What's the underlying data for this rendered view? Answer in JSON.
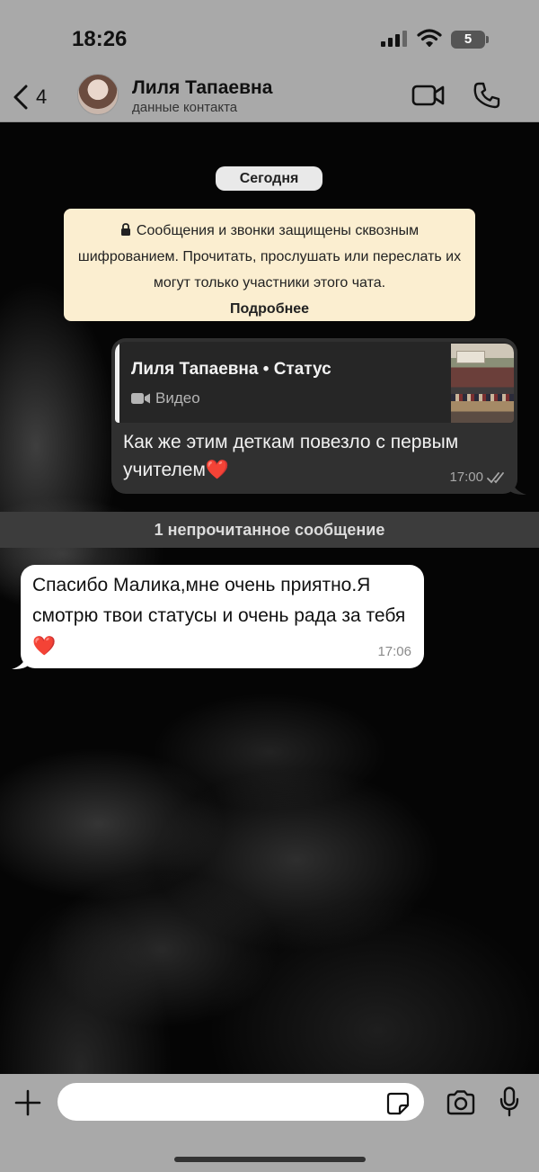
{
  "status_bar": {
    "time": "18:26",
    "battery": "5"
  },
  "header": {
    "back_count": "4",
    "contact_name": "Лиля Тапаевна",
    "contact_subtitle": "данные контакта",
    "icons": [
      "chevron-left-icon",
      "video-camera-icon",
      "phone-icon"
    ]
  },
  "chat": {
    "date_label": "Сегодня",
    "encryption_notice": {
      "text": "Сообщения и звонки защищены сквозным шифрованием. Прочитать, прослушать или переслать их могут только участники этого чата.",
      "link": "Подробнее"
    },
    "outgoing_message": {
      "quote_title": "Лиля Тапаевна • Статус",
      "quote_type": "Видео",
      "text": "Как же этим деткам повезло с первым учителем❤️",
      "time": "17:00",
      "status": "read"
    },
    "unread_divider": "1 непрочитанное сообщение",
    "incoming_message": {
      "text": "Спасибо Малика,мне очень приятно.Я смотрю твои статусы и очень рада за тебя❤️",
      "time": "17:06"
    }
  },
  "composer": {
    "input_value": "",
    "icons": [
      "plus-icon",
      "sticker-icon",
      "camera-icon",
      "microphone-icon"
    ]
  },
  "colors": {
    "bar_background": "#a9a9a9",
    "outgoing_bubble": "#303030",
    "incoming_bubble": "#ffffff",
    "encryption_notice": "#fbeed0",
    "unread_divider": "#3c3c3c"
  }
}
